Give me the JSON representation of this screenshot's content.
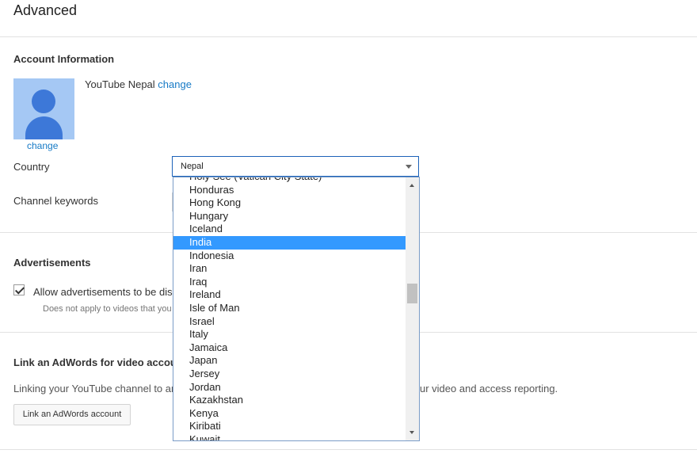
{
  "page": {
    "title": "Advanced"
  },
  "account": {
    "section_title": "Account Information",
    "channel_name": "YouTube Nepal",
    "name_change_link": "change",
    "avatar_change_link": "change"
  },
  "country": {
    "label": "Country",
    "selected_value": "Nepal"
  },
  "keywords": {
    "label": "Channel keywords"
  },
  "ads": {
    "section_title": "Advertisements",
    "checkbox_label": "Allow advertisements to be dis",
    "checkbox_checked": true,
    "note": "Does not apply to videos that you"
  },
  "adwords": {
    "section_title": "Link an AdWords for video accou",
    "body_left": "Linking your YouTube channel to ar",
    "body_right": "ur video and access reporting.",
    "button_label": "Link an AdWords account"
  },
  "dropdown": {
    "items": [
      "Holy See (Vatican City State)",
      "Honduras",
      "Hong Kong",
      "Hungary",
      "Iceland",
      "India",
      "Indonesia",
      "Iran",
      "Iraq",
      "Ireland",
      "Isle of Man",
      "Israel",
      "Italy",
      "Jamaica",
      "Japan",
      "Jersey",
      "Jordan",
      "Kazakhstan",
      "Kenya",
      "Kiribati",
      "Kuwait"
    ],
    "highlighted": "India"
  },
  "icons": [
    "user-avatar-icon",
    "dropdown-arrow-icon",
    "checkmark-icon",
    "scroll-up-icon",
    "scroll-down-icon"
  ]
}
